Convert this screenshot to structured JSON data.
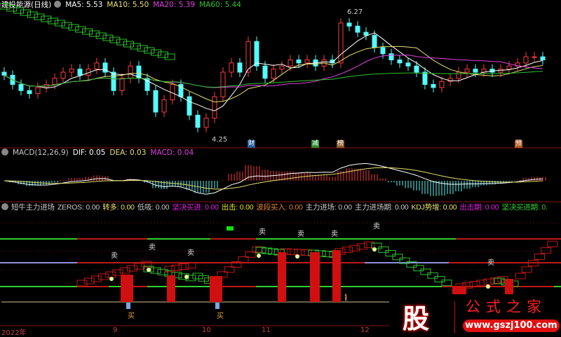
{
  "main_header": {
    "title": "建投能源(日线)",
    "ma5": "MA5: 5.53",
    "ma10": "MA10: 5.50",
    "ma20": "MA20: 5.39",
    "ma60": "MA60: 5.44"
  },
  "price_annotations": {
    "high": "6.27",
    "low": "4.25"
  },
  "event_tags": [
    {
      "text": "财",
      "color": "#2a5a9a"
    },
    {
      "text": "减",
      "color": "#2a8a2a"
    },
    {
      "text": "榜",
      "color": "#8a5a2a"
    },
    {
      "text": "预",
      "color": "#b05a20"
    }
  ],
  "macd_header": {
    "name": "MACD(12,26,9)",
    "dif": "DIF: 0.05",
    "dea": "DEA: 0.03",
    "macd": "MACD: 0.04"
  },
  "ind_header": {
    "name": "短牛主力进场",
    "zeros": "ZEROS: 0.00",
    "zhuanduo": "转多: 0.00",
    "dixi": "低吸: 0.00",
    "jianjue": "坚决买进: 0.00",
    "chuji": "出击: 0.00",
    "boduan": "波段买入: 0.00",
    "zhuli": "主力进场: 0.00",
    "zhuliqi": "主力进场期: 0.00",
    "kdj": "KDJ势增: 0.00",
    "chujiqi": "出击期: 0.00",
    "jianjueqi": "坚决买进期: 0."
  },
  "signals": {
    "sell": "卖",
    "buy": "买"
  },
  "x_axis": [
    "2022年",
    "9",
    "10",
    "11",
    "12"
  ],
  "logo": {
    "char": "股",
    "name": "公式之家",
    "url": "www.gszj100.com"
  },
  "colors": {
    "up": "#ff3c3c",
    "down": "#54fcfc",
    "ma5": "#ffffff",
    "ma10": "#e8e070",
    "ma20": "#e040e0",
    "ma60": "#30c030"
  },
  "chart_data": {
    "type": "candlestick",
    "title": "建投能源(日线)",
    "close": [
      5.25,
      5.1,
      5.0,
      4.95,
      5.05,
      5.1,
      5.2,
      5.3,
      5.35,
      5.25,
      5.35,
      5.45,
      5.3,
      5.0,
      5.2,
      5.4,
      5.2,
      5.0,
      4.65,
      4.85,
      5.1,
      4.9,
      4.6,
      4.4,
      4.55,
      4.9,
      5.3,
      5.45,
      5.3,
      5.8,
      5.4,
      5.2,
      5.35,
      5.4,
      5.5,
      5.45,
      5.5,
      5.4,
      5.5,
      5.45,
      6.1,
      6.05,
      5.95,
      5.9,
      5.7,
      5.6,
      5.5,
      5.45,
      5.4,
      5.3,
      5.1,
      5.05,
      5.15,
      5.2,
      5.3,
      5.35,
      5.3,
      5.35,
      5.3,
      5.35,
      5.4,
      5.45,
      5.55,
      5.55,
      5.5
    ],
    "open_first": 5.3,
    "ylim": [
      4.25,
      6.27
    ]
  }
}
